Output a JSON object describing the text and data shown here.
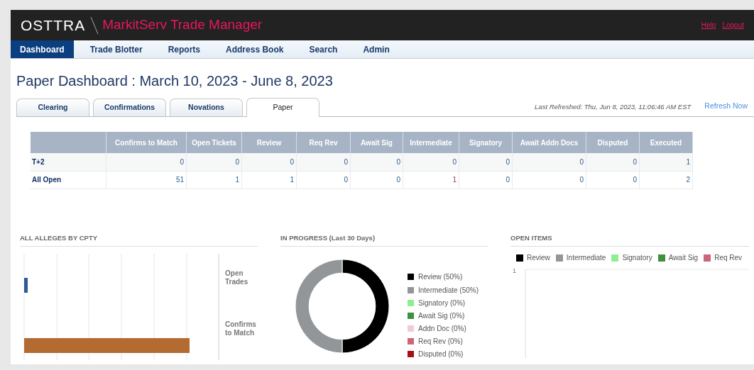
{
  "header": {
    "logo": "OSTTRA",
    "app_title": "MarkitServ Trade Manager",
    "links": [
      "Help",
      "Logout"
    ]
  },
  "nav": [
    {
      "label": "Dashboard",
      "selected": true
    },
    {
      "label": "Trade Blotter",
      "selected": false
    },
    {
      "label": "Reports",
      "selected": false
    },
    {
      "label": "Address Book",
      "selected": false
    },
    {
      "label": "Search",
      "selected": false
    },
    {
      "label": "Admin",
      "selected": false
    }
  ],
  "page_title": "Paper Dashboard : March 10, 2023 - June 8, 2023",
  "tabs": [
    {
      "label": "Clearing",
      "selected": false
    },
    {
      "label": "Confirmations",
      "selected": false
    },
    {
      "label": "Novations",
      "selected": false
    },
    {
      "label": "Paper",
      "selected": true
    }
  ],
  "last_refreshed": "Last Refreshed: Thu, Jun 8, 2023, 11:06:46 AM EST",
  "refresh_link": "Refresh Now",
  "table": {
    "columns": [
      "Confirms to Match",
      "Open Tickets",
      "Review",
      "Req Rev",
      "Await Sig",
      "Intermediate",
      "Signatory",
      "Await Addn Docs",
      "Disputed",
      "Executed"
    ],
    "rows": [
      {
        "label": "T+2",
        "cells": [
          {
            "value": "0",
            "flagged": false
          },
          {
            "value": "0",
            "flagged": false
          },
          {
            "value": "0",
            "flagged": false
          },
          {
            "value": "0",
            "flagged": false
          },
          {
            "value": "0",
            "flagged": false
          },
          {
            "value": "0",
            "flagged": false
          },
          {
            "value": "0",
            "flagged": false
          },
          {
            "value": "0",
            "flagged": false
          },
          {
            "value": "0",
            "flagged": false
          },
          {
            "value": "1",
            "flagged": false
          }
        ]
      },
      {
        "label": "All Open",
        "cells": [
          {
            "value": "51",
            "flagged": false
          },
          {
            "value": "1",
            "flagged": false
          },
          {
            "value": "1",
            "flagged": false
          },
          {
            "value": "0",
            "flagged": false
          },
          {
            "value": "0",
            "flagged": false
          },
          {
            "value": "1",
            "flagged": true
          },
          {
            "value": "0",
            "flagged": false
          },
          {
            "value": "0",
            "flagged": false
          },
          {
            "value": "0",
            "flagged": false
          },
          {
            "value": "2",
            "flagged": false
          }
        ]
      }
    ]
  },
  "alleges": {
    "title": "ALL ALLEGES BY CPTY",
    "categories": [
      "Open Trades",
      "Confirms to Match"
    ]
  },
  "in_progress": {
    "title": "IN PROGRESS (Last 30 Days)",
    "legend": [
      {
        "label": "Review (50%)",
        "color": "#000000"
      },
      {
        "label": "Intermediate (50%)",
        "color": "#939698"
      },
      {
        "label": "Signatory (0%)",
        "color": "#90ee90"
      },
      {
        "label": "Await Sig (0%)",
        "color": "#3e8f3e"
      },
      {
        "label": "Addn Doc (0%)",
        "color": "#f0ccd2"
      },
      {
        "label": "Req Rev (0%)",
        "color": "#cc6677"
      },
      {
        "label": "Disputed (0%)",
        "color": "#a50f15"
      }
    ],
    "chart_data": {
      "type": "donut",
      "values": [
        50,
        50,
        0,
        0,
        0,
        0,
        0
      ]
    }
  },
  "open_items": {
    "title": "OPEN ITEMS",
    "legend": [
      {
        "label": "Review",
        "color": "#000000"
      },
      {
        "label": "Intermediate",
        "color": "#939698"
      },
      {
        "label": "Signatory",
        "color": "#90ee90"
      },
      {
        "label": "Await Sig",
        "color": "#3e8f3e"
      },
      {
        "label": "Req Rev",
        "color": "#cc6677"
      }
    ],
    "y_tick": "1"
  }
}
